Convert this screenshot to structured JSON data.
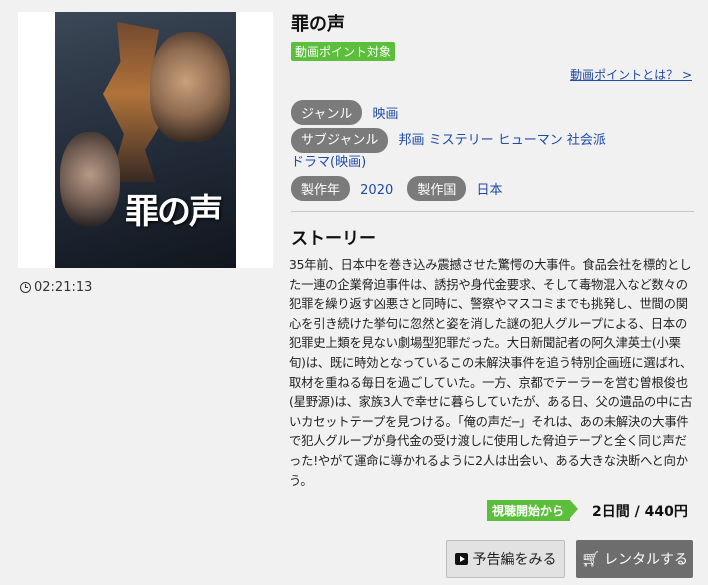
{
  "movie": {
    "title": "罪の声",
    "poster_title": "罪の声",
    "duration": "02:21:13"
  },
  "points": {
    "badge": "動画ポイント対象",
    "link": "動画ポイントとは？ >"
  },
  "meta": {
    "genre_label": "ジャンル",
    "genre_value": "映画",
    "subgenre_label": "サブジャンル",
    "subgenres": "邦画 ミステリー ヒューマン 社会派ドラマ(映画)",
    "year_label": "製作年",
    "year_value": "2020",
    "country_label": "製作国",
    "country_value": "日本"
  },
  "story": {
    "heading": "ストーリー",
    "text": "35年前、日本中を巻き込み震撼させた驚愕の大事件。食品会社を標的とした一連の企業脅迫事件は、誘拐や身代金要求、そして毒物混入など数々の犯罪を繰り返す凶悪さと同時に、警察やマスコミまでも挑発し、世間の関心を引き続けた挙句に忽然と姿を消した謎の犯人グループによる、日本の犯罪史上類を見ない劇場型犯罪だった。大日新聞記者の阿久津英士(小栗旬)は、既に時効となっているこの未解決事件を追う特別企画班に選ばれ、取材を重ねる毎日を過ごしていた。一方、京都でテーラーを営む曽根俊也(星野源)は、家族3人で幸せに暮らしていたが、ある日、父の遺品の中に古いカセットテープを見つける。「俺の声だ─」それは、あの未解決の大事件で犯人グループが身代金の受け渡しに使用した脅迫テープと全く同じ声だった!やがて運命に導かれるように2人は出会い、ある大きな決断へと向かう。"
  },
  "rental": {
    "badge": "視聴開始から",
    "price": "2日間 / 440円",
    "trailer_button": "予告編をみる",
    "rent_button": "レンタルする"
  },
  "colors": {
    "accent_green": "#5bbf3c",
    "link_blue": "#1f4aa8",
    "tag_gray": "#7b7b7b"
  }
}
